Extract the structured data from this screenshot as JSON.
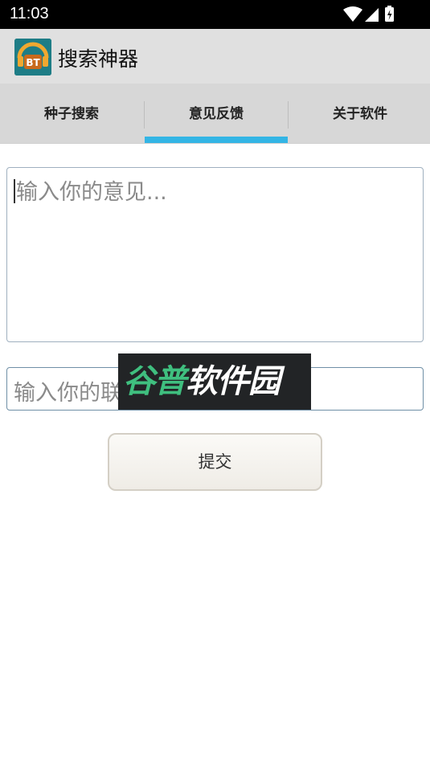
{
  "status_bar": {
    "time": "11:03"
  },
  "app_bar": {
    "title": "搜索神器",
    "logo_text": "BT"
  },
  "tabs": [
    {
      "label": "种子搜索"
    },
    {
      "label": "意见反馈"
    },
    {
      "label": "关于软件"
    }
  ],
  "selected_tab": 1,
  "form": {
    "feedback_placeholder": "输入你的意见...",
    "contact_placeholder": "输入你的联系方式",
    "submit_label": "提交"
  },
  "watermark": {
    "part1": "谷普",
    "part2": "软件园"
  },
  "colors": {
    "accent": "#33b5e5",
    "status_bar": "#000000",
    "app_bar": "#e0e0e0",
    "tab_bar": "#d7d7d7"
  }
}
